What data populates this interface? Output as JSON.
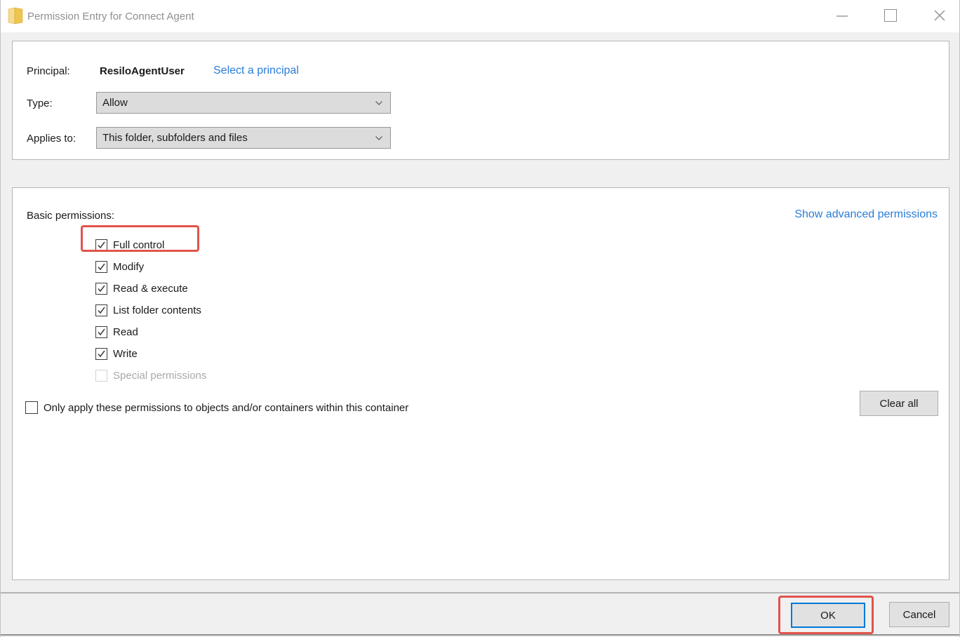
{
  "window": {
    "title": "Permission Entry for Connect Agent"
  },
  "form": {
    "principal": {
      "label": "Principal:",
      "value": "ResiloAgentUser",
      "action": "Select a principal"
    },
    "type": {
      "label": "Type:",
      "value": "Allow"
    },
    "applies_to": {
      "label": "Applies to:",
      "value": "This folder, subfolders and files"
    }
  },
  "permissions": {
    "heading": "Basic permissions:",
    "advanced_link": "Show advanced permissions",
    "items": [
      {
        "label": "Full control",
        "checked": true,
        "disabled": false,
        "annotated": true
      },
      {
        "label": "Modify",
        "checked": true,
        "disabled": false,
        "annotated": false
      },
      {
        "label": "Read & execute",
        "checked": true,
        "disabled": false,
        "annotated": false
      },
      {
        "label": "List folder contents",
        "checked": true,
        "disabled": false,
        "annotated": false
      },
      {
        "label": "Read",
        "checked": true,
        "disabled": false,
        "annotated": false
      },
      {
        "label": "Write",
        "checked": true,
        "disabled": false,
        "annotated": false
      },
      {
        "label": "Special permissions",
        "checked": false,
        "disabled": true,
        "annotated": false
      }
    ]
  },
  "options": {
    "only_apply": {
      "label": "Only apply these permissions to objects and/or containers within this container",
      "checked": false
    }
  },
  "buttons": {
    "clear_all": "Clear all",
    "ok": "OK",
    "cancel": "Cancel"
  },
  "icons": {
    "titlebar": "folder-icon",
    "dropdowns": "chevron-down-icon",
    "window_controls": [
      "minimize-icon",
      "maximize-icon",
      "close-icon"
    ],
    "checkboxes": "checkmark-icon"
  },
  "colors": {
    "link_blue": "#2b7cd8",
    "annotation_red": "#e0544b",
    "default_button_border": "#0078d7",
    "titlebar_text": "#8f8f8f"
  }
}
